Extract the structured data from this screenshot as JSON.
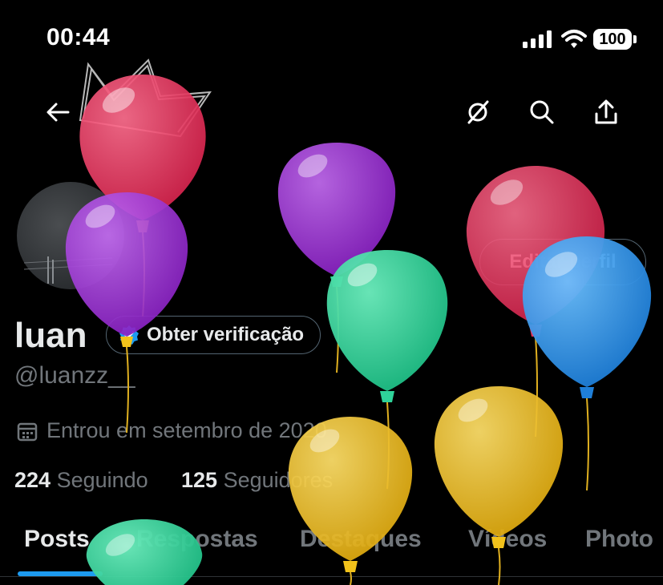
{
  "status_bar": {
    "time": "00:44",
    "battery": "100",
    "signal_icon": "cellular-signal-icon",
    "wifi_icon": "wifi-icon"
  },
  "header": {
    "back_icon": "arrow-left-icon",
    "icons": [
      "grok-slash-icon",
      "search-icon",
      "share-icon"
    ]
  },
  "profile": {
    "name": "luan",
    "verify_label": "Obter verificação",
    "handle": "@luanzz__",
    "joined": "Entrou em setembro de 2020",
    "edit_label": "Editar perfil",
    "following_count": "224",
    "following_label": "Seguindo",
    "followers_count": "125",
    "followers_label": "Seguidores"
  },
  "tabs": [
    {
      "label": "Posts",
      "active": true
    },
    {
      "label": "Respostas",
      "active": false
    },
    {
      "label": "Destaques",
      "active": false
    },
    {
      "label": "Vídeos",
      "active": false
    },
    {
      "label": "Photo",
      "active": false
    }
  ],
  "colors": {
    "accent": "#1d9bf0",
    "muted_text": "#71767b",
    "background": "#000000",
    "balloon_red": "#e8315a",
    "balloon_purple": "#9b2fd3",
    "balloon_green": "#2fd39a",
    "balloon_yellow": "#f2c21b",
    "balloon_blue": "#2a8ff0"
  }
}
